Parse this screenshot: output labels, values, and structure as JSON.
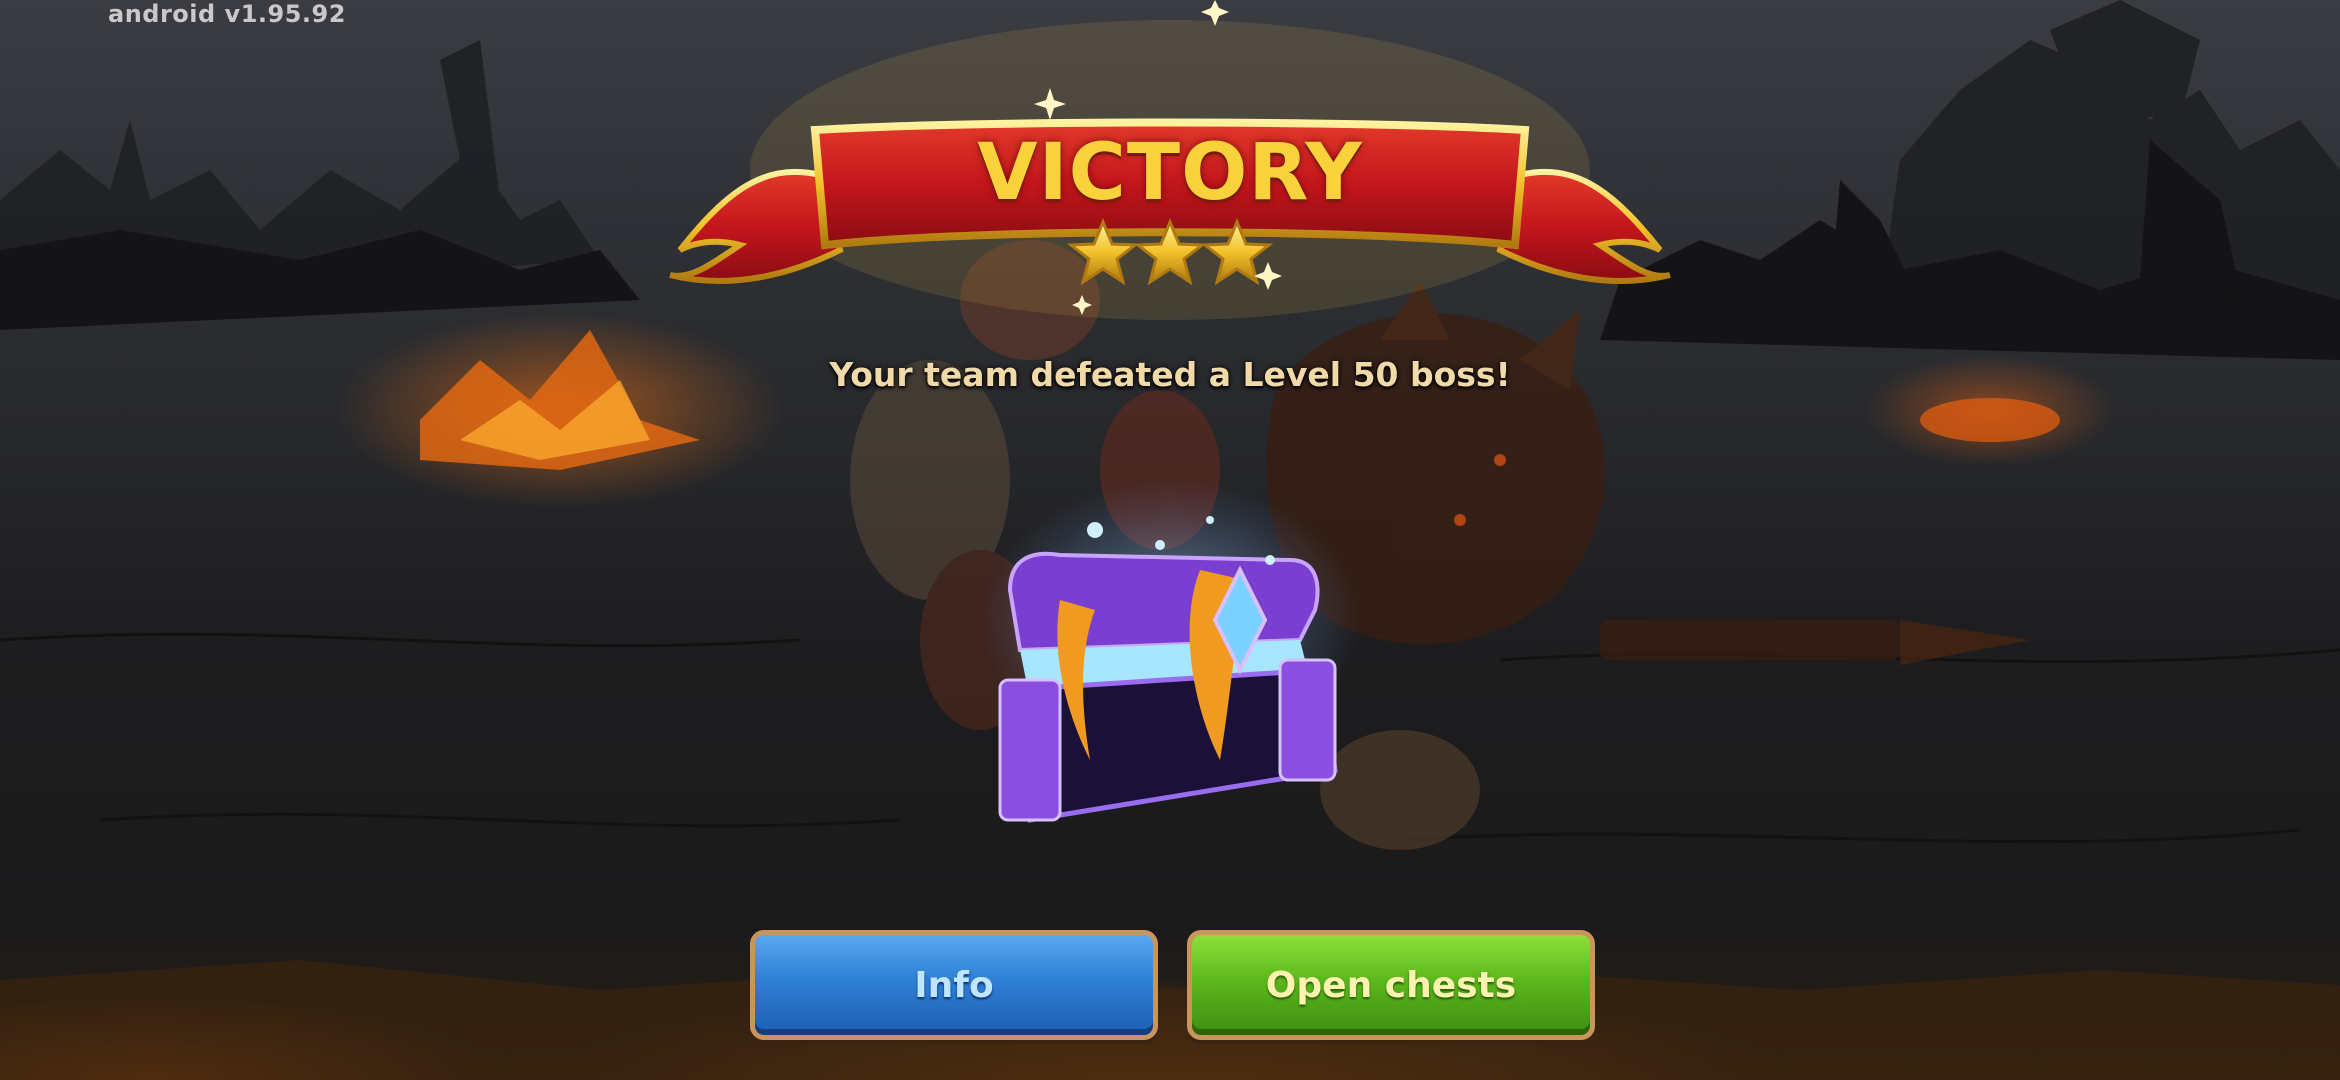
{
  "app": {
    "version_label": "android v1.95.92"
  },
  "result": {
    "title": "VICTORY",
    "star_count": 3,
    "subtitle": "Your team defeated a Level 50 boss!"
  },
  "actions": {
    "info_label": "Info",
    "open_chests_label": "Open chests"
  },
  "colors": {
    "banner_red": "#c4161c",
    "gold": "#f7d23a",
    "info_blue": "#2f7fd6",
    "open_green": "#5cb81c",
    "chest_purple": "#8a4fe0"
  }
}
